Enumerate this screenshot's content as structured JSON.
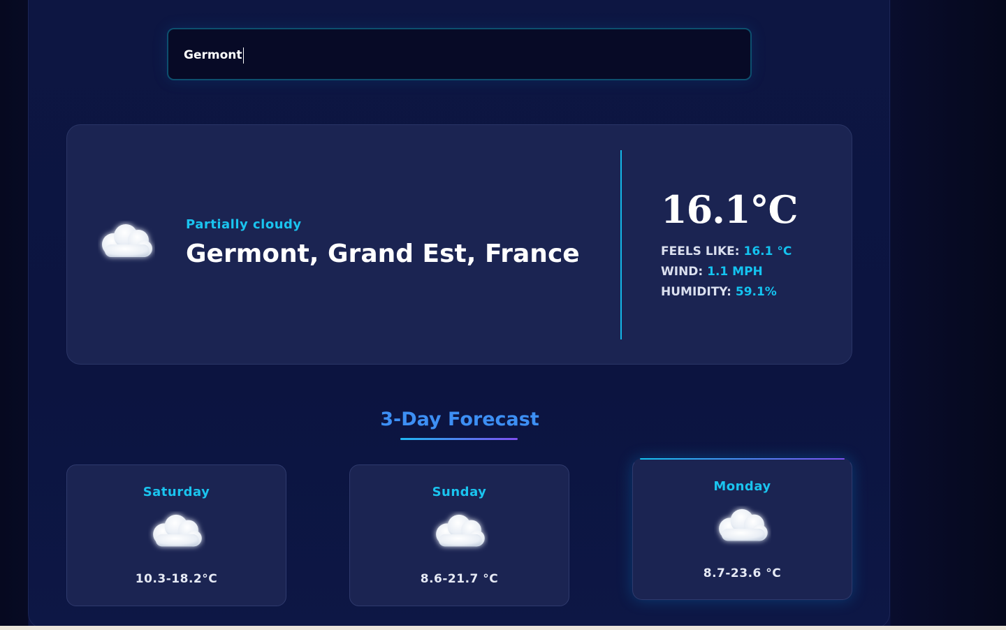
{
  "search": {
    "value": "Germont"
  },
  "current": {
    "condition": "Partially cloudy",
    "location": "Germont, Grand Est, France",
    "temperature": "16.1°C",
    "feels_like_label": "FEELS LIKE:",
    "feels_like_value": "16.1 °C",
    "wind_label": "WIND:",
    "wind_value": "1.1 MPH",
    "humidity_label": "HUMIDITY:",
    "humidity_value": "59.1%",
    "icon": "cloud-icon"
  },
  "forecast": {
    "title": "3-Day Forecast",
    "days": [
      {
        "name": "Saturday",
        "range": "10.3-18.2°C",
        "icon": "cloud-icon"
      },
      {
        "name": "Sunday",
        "range": "8.6-21.7 °C",
        "icon": "cloud-icon"
      },
      {
        "name": "Monday",
        "range": "8.7-23.6 °C",
        "icon": "cloud-icon"
      }
    ]
  },
  "colors": {
    "accent": "#14c3f0",
    "title_blue": "#3d8ff4",
    "gradient_end": "#7e4ff0",
    "card_bg": "#1b2452",
    "page_bg": "#0c1440"
  }
}
